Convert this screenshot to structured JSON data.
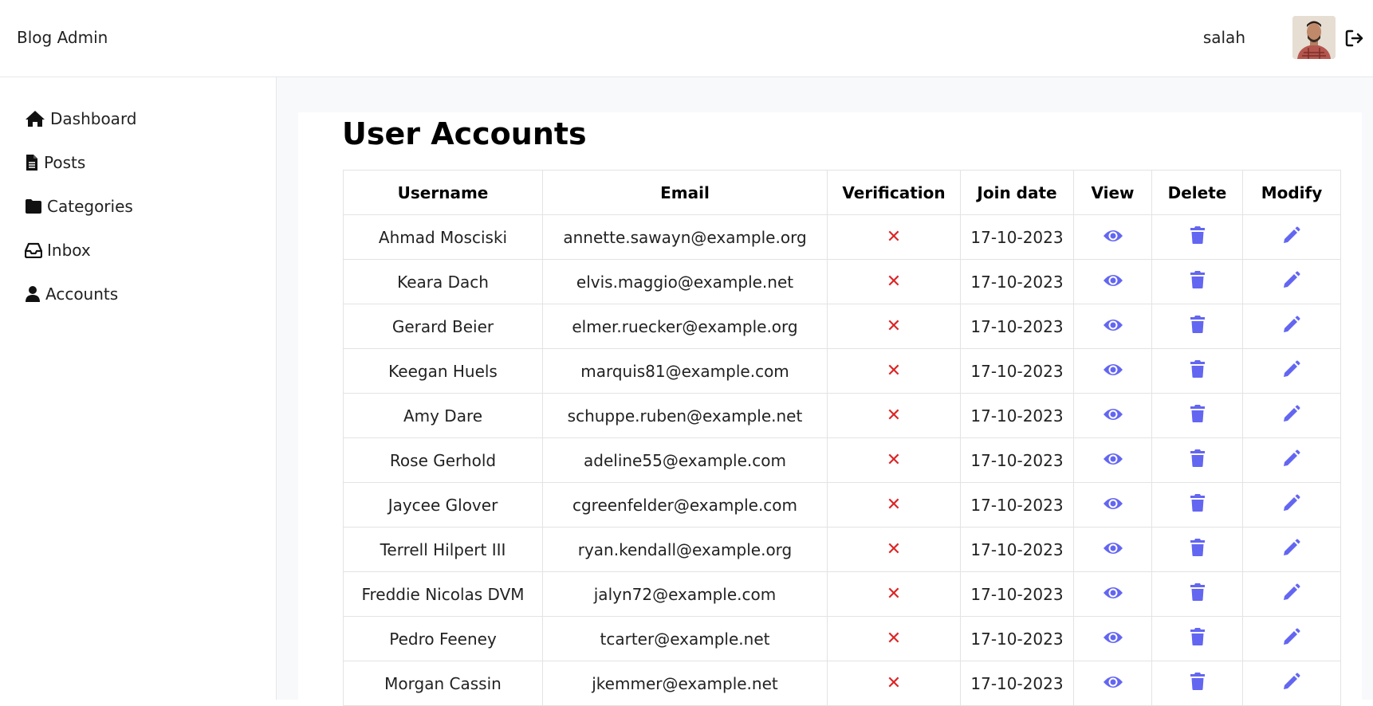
{
  "header": {
    "brand": "Blog Admin",
    "user_name": "salah"
  },
  "sidebar": {
    "items": [
      {
        "label": "Dashboard",
        "icon": "home-icon"
      },
      {
        "label": "Posts",
        "icon": "document-icon"
      },
      {
        "label": "Categories",
        "icon": "folder-icon"
      },
      {
        "label": "Inbox",
        "icon": "inbox-icon"
      },
      {
        "label": "Accounts",
        "icon": "user-icon"
      }
    ]
  },
  "main": {
    "title": "User Accounts",
    "columns": [
      "Username",
      "Email",
      "Verification",
      "Join date",
      "View",
      "Delete",
      "Modify"
    ],
    "rows": [
      {
        "username": "Ahmad Mosciski",
        "email": "annette.sawayn@example.org",
        "verified": "✕",
        "join_date": "17-10-2023"
      },
      {
        "username": "Keara Dach",
        "email": "elvis.maggio@example.net",
        "verified": "✕",
        "join_date": "17-10-2023"
      },
      {
        "username": "Gerard Beier",
        "email": "elmer.ruecker@example.org",
        "verified": "✕",
        "join_date": "17-10-2023"
      },
      {
        "username": "Keegan Huels",
        "email": "marquis81@example.com",
        "verified": "✕",
        "join_date": "17-10-2023"
      },
      {
        "username": "Amy Dare",
        "email": "schuppe.ruben@example.net",
        "verified": "✕",
        "join_date": "17-10-2023"
      },
      {
        "username": "Rose Gerhold",
        "email": "adeline55@example.com",
        "verified": "✕",
        "join_date": "17-10-2023"
      },
      {
        "username": "Jaycee Glover",
        "email": "cgreenfelder@example.com",
        "verified": "✕",
        "join_date": "17-10-2023"
      },
      {
        "username": "Terrell Hilpert III",
        "email": "ryan.kendall@example.org",
        "verified": "✕",
        "join_date": "17-10-2023"
      },
      {
        "username": "Freddie Nicolas DVM",
        "email": "jalyn72@example.com",
        "verified": "✕",
        "join_date": "17-10-2023"
      },
      {
        "username": "Pedro Feeney",
        "email": "tcarter@example.net",
        "verified": "✕",
        "join_date": "17-10-2023"
      },
      {
        "username": "Morgan Cassin",
        "email": "jkemmer@example.net",
        "verified": "✕",
        "join_date": "17-10-2023"
      }
    ]
  },
  "colors": {
    "action_icon": "#6366f1",
    "unverified_mark": "#dc2626",
    "page_background": "#f8f9fb"
  }
}
